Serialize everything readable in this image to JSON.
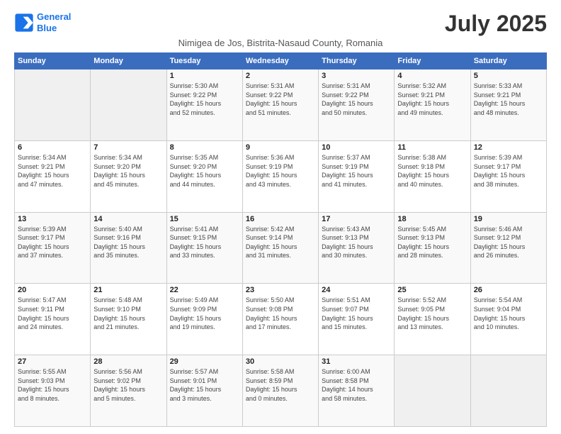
{
  "logo": {
    "line1": "General",
    "line2": "Blue"
  },
  "title": "July 2025",
  "subtitle": "Nimigea de Jos, Bistrita-Nasaud County, Romania",
  "header": {
    "days": [
      "Sunday",
      "Monday",
      "Tuesday",
      "Wednesday",
      "Thursday",
      "Friday",
      "Saturday"
    ]
  },
  "weeks": [
    {
      "cells": [
        {
          "day": "",
          "info": ""
        },
        {
          "day": "",
          "info": ""
        },
        {
          "day": "1",
          "info": "Sunrise: 5:30 AM\nSunset: 9:22 PM\nDaylight: 15 hours\nand 52 minutes."
        },
        {
          "day": "2",
          "info": "Sunrise: 5:31 AM\nSunset: 9:22 PM\nDaylight: 15 hours\nand 51 minutes."
        },
        {
          "day": "3",
          "info": "Sunrise: 5:31 AM\nSunset: 9:22 PM\nDaylight: 15 hours\nand 50 minutes."
        },
        {
          "day": "4",
          "info": "Sunrise: 5:32 AM\nSunset: 9:21 PM\nDaylight: 15 hours\nand 49 minutes."
        },
        {
          "day": "5",
          "info": "Sunrise: 5:33 AM\nSunset: 9:21 PM\nDaylight: 15 hours\nand 48 minutes."
        }
      ]
    },
    {
      "cells": [
        {
          "day": "6",
          "info": "Sunrise: 5:34 AM\nSunset: 9:21 PM\nDaylight: 15 hours\nand 47 minutes."
        },
        {
          "day": "7",
          "info": "Sunrise: 5:34 AM\nSunset: 9:20 PM\nDaylight: 15 hours\nand 45 minutes."
        },
        {
          "day": "8",
          "info": "Sunrise: 5:35 AM\nSunset: 9:20 PM\nDaylight: 15 hours\nand 44 minutes."
        },
        {
          "day": "9",
          "info": "Sunrise: 5:36 AM\nSunset: 9:19 PM\nDaylight: 15 hours\nand 43 minutes."
        },
        {
          "day": "10",
          "info": "Sunrise: 5:37 AM\nSunset: 9:19 PM\nDaylight: 15 hours\nand 41 minutes."
        },
        {
          "day": "11",
          "info": "Sunrise: 5:38 AM\nSunset: 9:18 PM\nDaylight: 15 hours\nand 40 minutes."
        },
        {
          "day": "12",
          "info": "Sunrise: 5:39 AM\nSunset: 9:17 PM\nDaylight: 15 hours\nand 38 minutes."
        }
      ]
    },
    {
      "cells": [
        {
          "day": "13",
          "info": "Sunrise: 5:39 AM\nSunset: 9:17 PM\nDaylight: 15 hours\nand 37 minutes."
        },
        {
          "day": "14",
          "info": "Sunrise: 5:40 AM\nSunset: 9:16 PM\nDaylight: 15 hours\nand 35 minutes."
        },
        {
          "day": "15",
          "info": "Sunrise: 5:41 AM\nSunset: 9:15 PM\nDaylight: 15 hours\nand 33 minutes."
        },
        {
          "day": "16",
          "info": "Sunrise: 5:42 AM\nSunset: 9:14 PM\nDaylight: 15 hours\nand 31 minutes."
        },
        {
          "day": "17",
          "info": "Sunrise: 5:43 AM\nSunset: 9:13 PM\nDaylight: 15 hours\nand 30 minutes."
        },
        {
          "day": "18",
          "info": "Sunrise: 5:45 AM\nSunset: 9:13 PM\nDaylight: 15 hours\nand 28 minutes."
        },
        {
          "day": "19",
          "info": "Sunrise: 5:46 AM\nSunset: 9:12 PM\nDaylight: 15 hours\nand 26 minutes."
        }
      ]
    },
    {
      "cells": [
        {
          "day": "20",
          "info": "Sunrise: 5:47 AM\nSunset: 9:11 PM\nDaylight: 15 hours\nand 24 minutes."
        },
        {
          "day": "21",
          "info": "Sunrise: 5:48 AM\nSunset: 9:10 PM\nDaylight: 15 hours\nand 21 minutes."
        },
        {
          "day": "22",
          "info": "Sunrise: 5:49 AM\nSunset: 9:09 PM\nDaylight: 15 hours\nand 19 minutes."
        },
        {
          "day": "23",
          "info": "Sunrise: 5:50 AM\nSunset: 9:08 PM\nDaylight: 15 hours\nand 17 minutes."
        },
        {
          "day": "24",
          "info": "Sunrise: 5:51 AM\nSunset: 9:07 PM\nDaylight: 15 hours\nand 15 minutes."
        },
        {
          "day": "25",
          "info": "Sunrise: 5:52 AM\nSunset: 9:05 PM\nDaylight: 15 hours\nand 13 minutes."
        },
        {
          "day": "26",
          "info": "Sunrise: 5:54 AM\nSunset: 9:04 PM\nDaylight: 15 hours\nand 10 minutes."
        }
      ]
    },
    {
      "cells": [
        {
          "day": "27",
          "info": "Sunrise: 5:55 AM\nSunset: 9:03 PM\nDaylight: 15 hours\nand 8 minutes."
        },
        {
          "day": "28",
          "info": "Sunrise: 5:56 AM\nSunset: 9:02 PM\nDaylight: 15 hours\nand 5 minutes."
        },
        {
          "day": "29",
          "info": "Sunrise: 5:57 AM\nSunset: 9:01 PM\nDaylight: 15 hours\nand 3 minutes."
        },
        {
          "day": "30",
          "info": "Sunrise: 5:58 AM\nSunset: 8:59 PM\nDaylight: 15 hours\nand 0 minutes."
        },
        {
          "day": "31",
          "info": "Sunrise: 6:00 AM\nSunset: 8:58 PM\nDaylight: 14 hours\nand 58 minutes."
        },
        {
          "day": "",
          "info": ""
        },
        {
          "day": "",
          "info": ""
        }
      ]
    }
  ]
}
